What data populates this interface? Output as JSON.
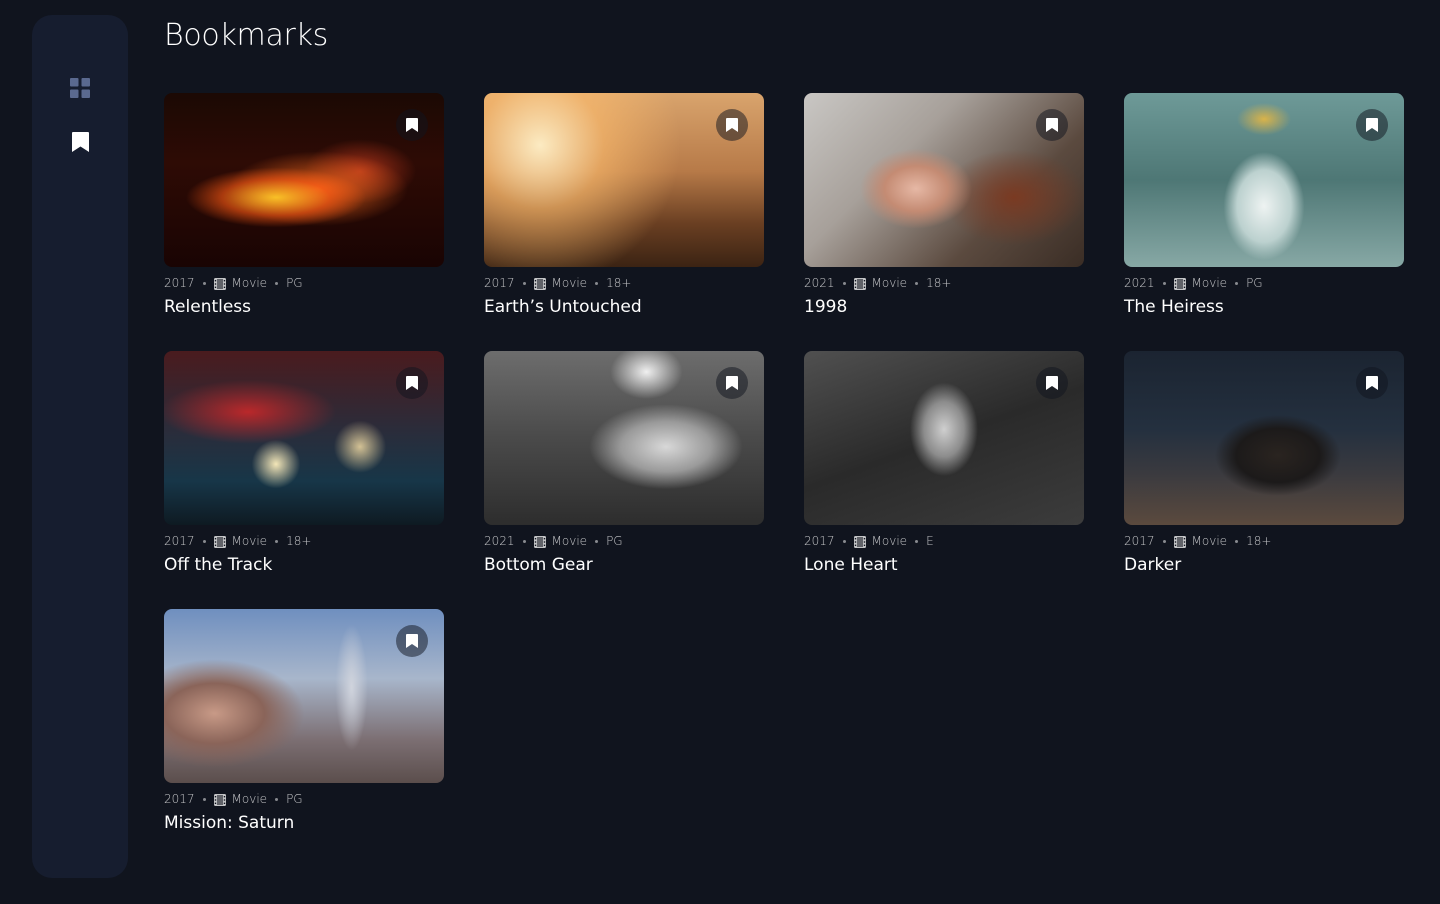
{
  "page": {
    "title": "Bookmarks"
  },
  "sidebar": {
    "items": [
      {
        "name": "home",
        "icon": "grid-icon",
        "color": "#5a698f"
      },
      {
        "name": "bookmarks",
        "icon": "bookmark-icon",
        "color": "#ffffff"
      }
    ]
  },
  "cards": [
    {
      "year": "2017",
      "category": "Movie",
      "rating": "PG",
      "title": "Relentless",
      "bookmark_icon": "bookmark-filled-icon"
    },
    {
      "year": "2017",
      "category": "Movie",
      "rating": "18+",
      "title": "Earth’s Untouched",
      "bookmark_icon": "bookmark-filled-icon"
    },
    {
      "year": "2021",
      "category": "Movie",
      "rating": "18+",
      "title": "1998",
      "bookmark_icon": "bookmark-filled-icon"
    },
    {
      "year": "2021",
      "category": "Movie",
      "rating": "PG",
      "title": "The Heiress",
      "bookmark_icon": "bookmark-filled-icon"
    },
    {
      "year": "2017",
      "category": "Movie",
      "rating": "18+",
      "title": "Off the Track",
      "bookmark_icon": "bookmark-filled-icon"
    },
    {
      "year": "2021",
      "category": "Movie",
      "rating": "PG",
      "title": "Bottom Gear",
      "bookmark_icon": "bookmark-filled-icon"
    },
    {
      "year": "2017",
      "category": "Movie",
      "rating": "E",
      "title": "Lone Heart",
      "bookmark_icon": "bookmark-filled-icon"
    },
    {
      "year": "2017",
      "category": "Movie",
      "rating": "18+",
      "title": "Darker",
      "bookmark_icon": "bookmark-filled-icon"
    },
    {
      "year": "2017",
      "category": "Movie",
      "rating": "PG",
      "title": "Mission: Saturn",
      "bookmark_icon": "bookmark-filled-icon"
    }
  ],
  "colors": {
    "background": "#10141e",
    "sidebar": "#161d2f",
    "nav_inactive": "#5a698f",
    "text": "#ffffff"
  }
}
